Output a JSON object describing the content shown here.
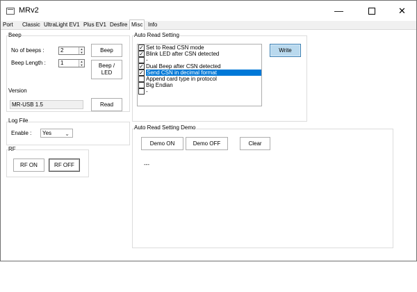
{
  "window": {
    "title": "MRv2",
    "minimize_glyph": "—",
    "close_glyph": "✕"
  },
  "tabs": [
    {
      "label": "Port"
    },
    {
      "label": "Classic"
    },
    {
      "label": "UltraLight EV1"
    },
    {
      "label": "Plus EV1"
    },
    {
      "label": "Desfire"
    },
    {
      "label": "Misc",
      "active": true
    },
    {
      "label": "Info"
    }
  ],
  "beep": {
    "group_label": "Beep",
    "num_beeps_label": "No of beeps :",
    "num_beeps_value": "2",
    "beep_length_label": "Beep Length :",
    "beep_length_value": "1",
    "beep_button": "Beep",
    "beep_led_button": "Beep / LED"
  },
  "version": {
    "group_label": "Version",
    "value": "MR-USB 1.5",
    "read_button": "Read"
  },
  "log_file": {
    "group_label": "Log File",
    "enable_label": "Enable :",
    "enable_value": "Yes"
  },
  "rf": {
    "group_label": "RF",
    "on_button": "RF ON",
    "off_button": "RF OFF"
  },
  "auto_read": {
    "group_label": "Auto Read Setting",
    "write_button": "Write",
    "items": [
      {
        "label": "Set to Read CSN mode",
        "checked": true
      },
      {
        "label": "Blink LED after CSN detected",
        "checked": true
      },
      {
        "label": "-",
        "checked": false
      },
      {
        "label": "Dual Beep after CSN detected",
        "checked": true
      },
      {
        "label": "Send CSN in decimal format",
        "checked": true,
        "selected": true
      },
      {
        "label": "Append card type in protocol",
        "checked": false
      },
      {
        "label": "Big Endian",
        "checked": false
      },
      {
        "label": "-",
        "checked": false
      }
    ]
  },
  "demo": {
    "group_label": "Auto Read Setting Demo",
    "demo_on_button": "Demo ON",
    "demo_off_button": "Demo OFF",
    "clear_button": "Clear",
    "output_text": "---"
  },
  "icons": {
    "checkmark": "✓",
    "spin_up": "▲",
    "spin_down": "▼",
    "combo_chevron": "⌄"
  },
  "colors": {
    "selection": "#0078d7",
    "write_button_bg": "#b9d9ee"
  }
}
